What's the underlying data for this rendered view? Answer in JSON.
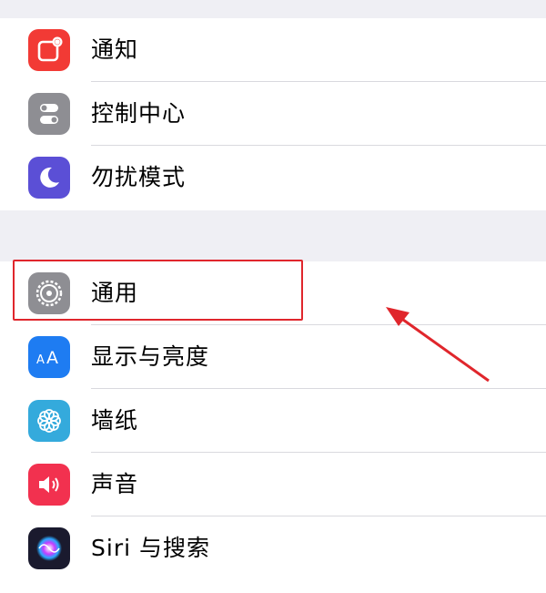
{
  "colors": {
    "background": "#efeff4",
    "cell": "#ffffff",
    "separator": "#d9d9de",
    "highlight": "#e0262c"
  },
  "group1": {
    "items": [
      {
        "label": "通知",
        "icon": "notification-icon",
        "color": "#f23a35"
      },
      {
        "label": "控制中心",
        "icon": "control-center-icon",
        "color": "#8e8e93"
      },
      {
        "label": "勿扰模式",
        "icon": "moon-icon",
        "color": "#5b4fd6"
      }
    ]
  },
  "group2": {
    "items": [
      {
        "label": "通用",
        "icon": "gear-icon",
        "color": "#8e8e93"
      },
      {
        "label": "显示与亮度",
        "icon": "display-aa-icon",
        "color": "#1e7cf2"
      },
      {
        "label": "墙纸",
        "icon": "wallpaper-flower-icon",
        "color": "#34aadc"
      },
      {
        "label": "声音",
        "icon": "speaker-icon",
        "color": "#f2314f"
      },
      {
        "label": "Siri 与搜索",
        "icon": "siri-icon",
        "color": "#1a1a2e"
      }
    ]
  },
  "annotation": {
    "target": "通用",
    "arrow_icon": "red-arrow-icon"
  }
}
